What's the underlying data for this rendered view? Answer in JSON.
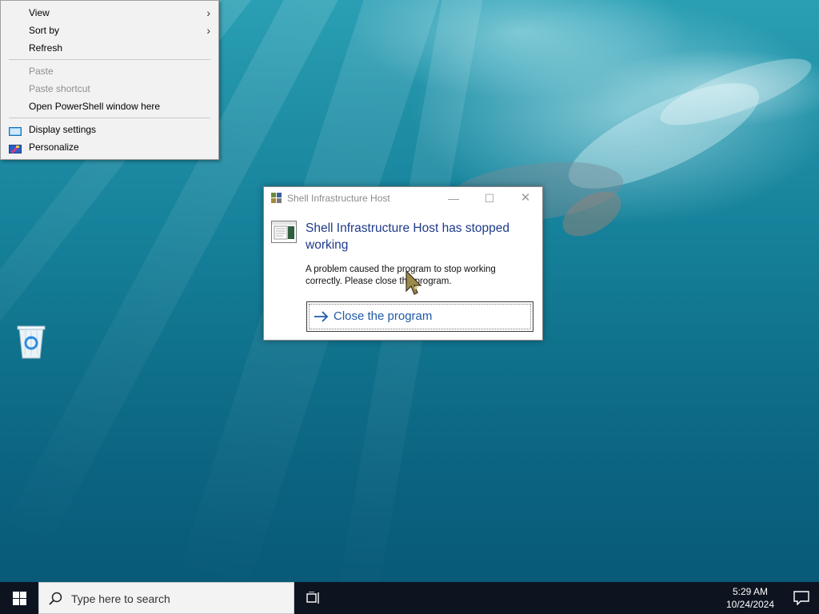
{
  "desktop": {
    "wallpaper_colors": [
      "#2a9fb4",
      "#10728d",
      "#085a78"
    ],
    "icons": [
      {
        "name": "recycle-bin-icon",
        "label": ""
      }
    ]
  },
  "context_menu": {
    "items": [
      {
        "label": "View",
        "has_submenu": true,
        "disabled": false,
        "icon": ""
      },
      {
        "label": "Sort by",
        "has_submenu": true,
        "disabled": false,
        "icon": ""
      },
      {
        "label": "Refresh",
        "has_submenu": false,
        "disabled": false,
        "icon": ""
      },
      {
        "label": "Paste",
        "has_submenu": false,
        "disabled": true,
        "icon": ""
      },
      {
        "label": "Paste shortcut",
        "has_submenu": false,
        "disabled": true,
        "icon": ""
      },
      {
        "label": "Open PowerShell window here",
        "has_submenu": false,
        "disabled": false,
        "icon": ""
      },
      {
        "label": "Display settings",
        "has_submenu": false,
        "disabled": false,
        "icon": "display-settings-icon"
      },
      {
        "label": "Personalize",
        "has_submenu": false,
        "disabled": false,
        "icon": "personalize-icon"
      }
    ],
    "submenu_arrow": "›"
  },
  "dialog": {
    "title": "Shell Infrastructure Host",
    "minimize_glyph": "—",
    "maximize_glyph": "☐",
    "close_glyph": "✕",
    "heading": "Shell Infrastructure Host has stopped working",
    "body": "A problem caused the program to stop working correctly. Please close the program.",
    "command_label": "Close the program",
    "heading_color": "#1f3a8a",
    "command_color": "#1f5aa6"
  },
  "taskbar": {
    "search_placeholder": "Type here to search",
    "clock_time": "5:29 AM",
    "clock_date": "10/24/2024",
    "background": "#0d1420"
  }
}
